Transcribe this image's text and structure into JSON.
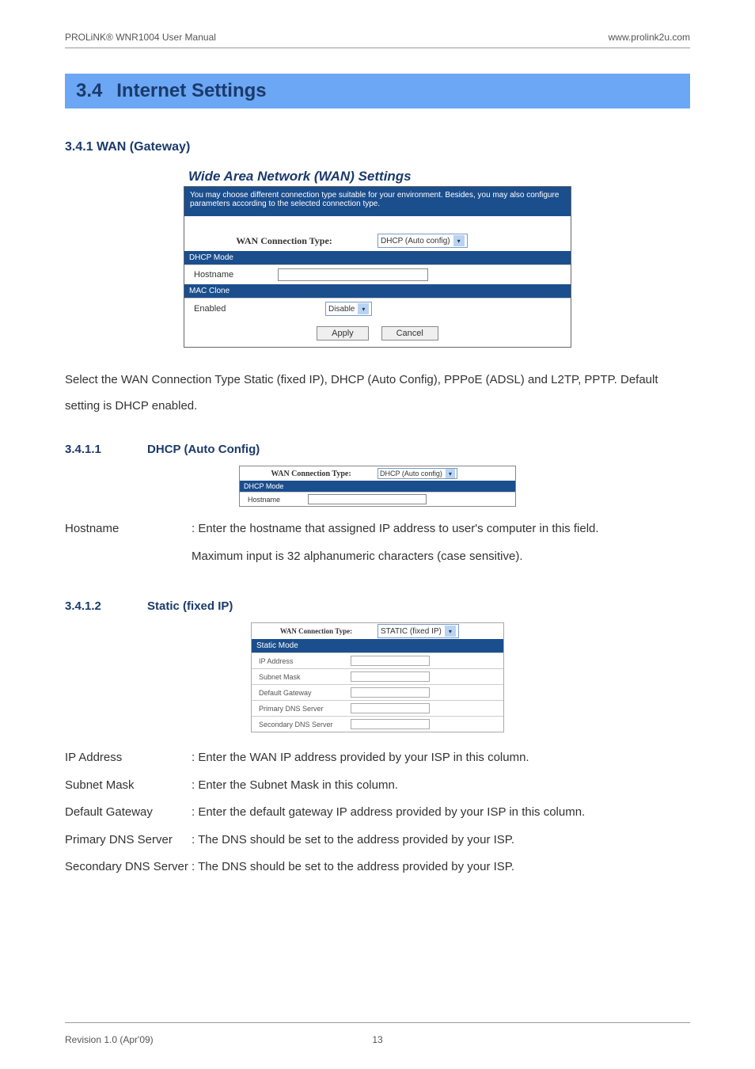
{
  "header": {
    "left": "PROLiNK® WNR1004 User Manual",
    "right": "www.prolink2u.com"
  },
  "section_banner": {
    "num": "3.4",
    "title": "Internet Settings"
  },
  "sub_3_4_1": "3.4.1  WAN (Gateway)",
  "wan_panel1": {
    "heading": "Wide Area Network (WAN) Settings",
    "desc": "You may choose different connection type suitable for your environment. Besides, you may also configure parameters according to the selected connection type.",
    "conn_type_label": "WAN Connection Type:",
    "conn_type_value": "DHCP (Auto config)",
    "dhcp_mode": "DHCP Mode",
    "hostname_label": "Hostname",
    "mac_clone": "MAC Clone",
    "enabled_label": "Enabled",
    "enabled_value": "Disable",
    "apply": "Apply",
    "cancel": "Cancel"
  },
  "body_text1": "Select the WAN Connection Type Static (fixed IP), DHCP (Auto Config), PPPoE (ADSL) and L2TP, PPTP. Default setting is DHCP enabled.",
  "sub_3_4_1_1": {
    "num": "3.4.1.1",
    "title": "DHCP (Auto Config)"
  },
  "small_panel_dhcp": {
    "conn_type_label": "WAN Connection Type:",
    "conn_type_value": "DHCP (Auto config)",
    "dhcp_mode": "DHCP Mode",
    "hostname_label": "Hostname"
  },
  "hostname_desc": {
    "term": "Hostname",
    "def": ": Enter the hostname that assigned IP address to user's computer in this field.",
    "cont": "Maximum input is 32 alphanumeric characters (case sensitive)."
  },
  "sub_3_4_1_2": {
    "num": "3.4.1.2",
    "title": "Static (fixed IP)"
  },
  "static_panel": {
    "conn_type_label": "WAN Connection Type:",
    "conn_type_value": "STATIC (fixed IP)",
    "static_mode": "Static Mode",
    "rows": [
      "IP Address",
      "Subnet Mask",
      "Default Gateway",
      "Primary DNS Server",
      "Secondary DNS Server"
    ]
  },
  "static_descs": [
    {
      "term": "IP Address",
      "def": ": Enter the WAN IP address provided by your ISP in this column."
    },
    {
      "term": "Subnet Mask",
      "def": ": Enter the Subnet Mask in this column."
    },
    {
      "term": "Default Gateway",
      "def": ": Enter the default gateway IP address provided by your ISP in this column."
    },
    {
      "term": "Primary DNS Server",
      "def": ": The DNS should be set to the address provided by your ISP."
    },
    {
      "term": "Secondary DNS Server",
      "def": ": The DNS should be set to the address provided by your ISP."
    }
  ],
  "footer": {
    "left": "Revision 1.0 (Apr'09)",
    "center": "13"
  }
}
